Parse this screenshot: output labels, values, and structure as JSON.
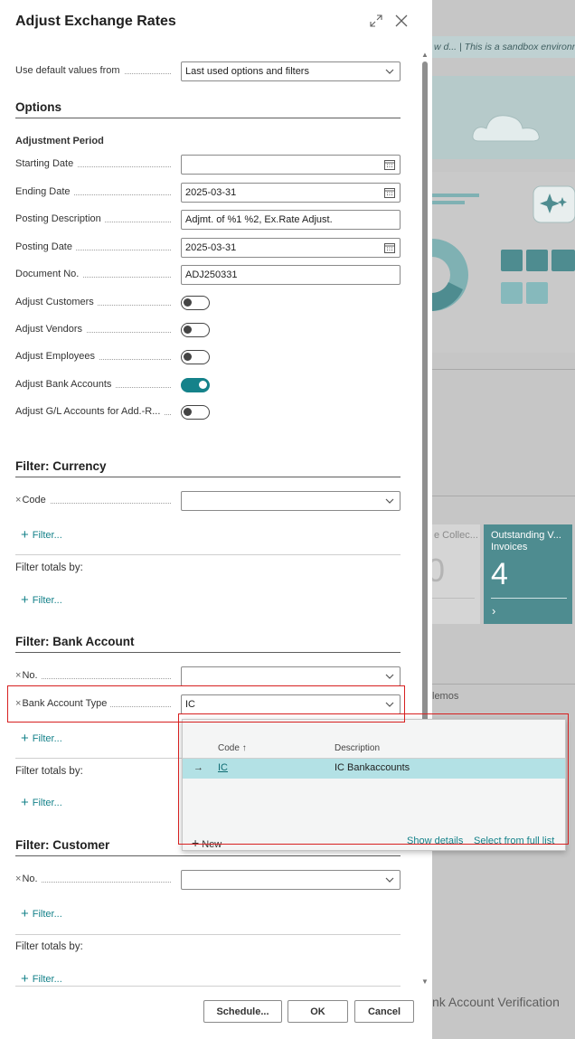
{
  "background": {
    "banner_text": "w d...  |  This is a sandbox environment",
    "tile_left_label": "e Collec...",
    "tile_left_value": "0",
    "tile_right_label": "Outstanding V... Invoices",
    "tile_right_value": "4",
    "tile_arrow": "›",
    "memos_label": "lemos",
    "verification_label": "nk Account Verification"
  },
  "dialog": {
    "title": "Adjust Exchange Rates",
    "expand_icon": "expand-icon",
    "close_icon": "close-icon",
    "defaults": {
      "label": "Use default values from",
      "value": "Last used options and filters"
    },
    "options_section": "Options",
    "adjustment_period": "Adjustment Period",
    "fields": {
      "starting_date": {
        "label": "Starting Date",
        "value": ""
      },
      "ending_date": {
        "label": "Ending Date",
        "value": "2025-03-31"
      },
      "posting_description": {
        "label": "Posting Description",
        "value": "Adjmt. of %1 %2, Ex.Rate Adjust."
      },
      "posting_date": {
        "label": "Posting Date",
        "value": "2025-03-31"
      },
      "document_no": {
        "label": "Document No.",
        "value": "ADJ250331"
      }
    },
    "toggles": {
      "adjust_customers": {
        "label": "Adjust Customers",
        "on": false
      },
      "adjust_vendors": {
        "label": "Adjust Vendors",
        "on": false
      },
      "adjust_employees": {
        "label": "Adjust Employees",
        "on": false
      },
      "adjust_bank_accounts": {
        "label": "Adjust Bank Accounts",
        "on": true
      },
      "adjust_gl_accounts": {
        "label": "Adjust G/L Accounts for Add.-R...",
        "on": false
      }
    },
    "filter_currency": {
      "title": "Filter: Currency",
      "code_label": "Code",
      "code_value": "",
      "filter_link": "Filter...",
      "totals_label": "Filter totals by:",
      "totals_filter_link": "Filter..."
    },
    "filter_bank_account": {
      "title": "Filter: Bank Account",
      "no_label": "No.",
      "no_value": "",
      "type_label": "Bank Account Type",
      "type_value": "IC",
      "filter_link": "Filter...",
      "totals_label": "Filter totals by:",
      "totals_filter_link": "Filter..."
    },
    "filter_customer": {
      "title": "Filter: Customer",
      "no_label": "No.",
      "no_value": "",
      "filter_link": "Filter...",
      "totals_label": "Filter totals by:",
      "totals_filter_link": "Filter..."
    },
    "remove_filter_glyph": "×",
    "footer": {
      "schedule": "Schedule...",
      "ok": "OK",
      "cancel": "Cancel"
    }
  },
  "dropdown": {
    "col_code": "Code",
    "sort_arrow": "↑",
    "col_description": "Description",
    "row_arrow": "→",
    "row_code": "IC",
    "row_description": "IC Bankaccounts",
    "new": "New",
    "show_details": "Show details",
    "select_full_list": "Select from full list"
  },
  "colors": {
    "accent": "#15828a",
    "highlight_row": "#b3e1e5",
    "annotation": "#d72020",
    "tile_teal": "#4e8c90"
  }
}
